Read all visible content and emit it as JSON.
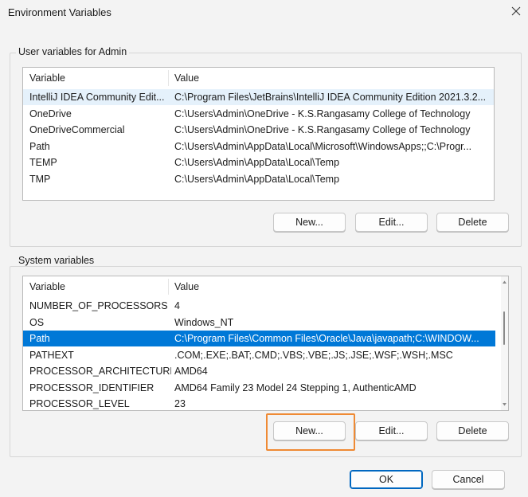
{
  "window": {
    "title": "Environment Variables",
    "close_icon": "close-icon"
  },
  "user_vars": {
    "group_label": "User variables for Admin",
    "columns": [
      "Variable",
      "Value"
    ],
    "rows": [
      [
        "IntelliJ IDEA Community Edit...",
        "C:\\Program Files\\JetBrains\\IntelliJ IDEA Community Edition 2021.3.2..."
      ],
      [
        "OneDrive",
        "C:\\Users\\Admin\\OneDrive - K.S.Rangasamy College of Technology"
      ],
      [
        "OneDriveCommercial",
        "C:\\Users\\Admin\\OneDrive - K.S.Rangasamy College of Technology"
      ],
      [
        "Path",
        "C:\\Users\\Admin\\AppData\\Local\\Microsoft\\WindowsApps;;C:\\Progr..."
      ],
      [
        "TEMP",
        "C:\\Users\\Admin\\AppData\\Local\\Temp"
      ],
      [
        "TMP",
        "C:\\Users\\Admin\\AppData\\Local\\Temp"
      ]
    ],
    "buttons": {
      "new": "New...",
      "edit": "Edit...",
      "delete": "Delete"
    }
  },
  "system_vars": {
    "group_label": "System variables",
    "columns": [
      "Variable",
      "Value"
    ],
    "rows": [
      [
        "NUMBER_OF_PROCESSORS",
        "4"
      ],
      [
        "OS",
        "Windows_NT"
      ],
      [
        "Path",
        "C:\\Program Files\\Common Files\\Oracle\\Java\\javapath;C:\\WINDOW..."
      ],
      [
        "PATHEXT",
        ".COM;.EXE;.BAT;.CMD;.VBS;.VBE;.JS;.JSE;.WSF;.WSH;.MSC"
      ],
      [
        "PROCESSOR_ARCHITECTURE",
        "AMD64"
      ],
      [
        "PROCESSOR_IDENTIFIER",
        "AMD64 Family 23 Model 24 Stepping 1, AuthenticAMD"
      ],
      [
        "PROCESSOR_LEVEL",
        "23"
      ]
    ],
    "selected_index": 2,
    "buttons": {
      "new": "New...",
      "edit": "Edit...",
      "delete": "Delete"
    }
  },
  "footer": {
    "ok": "OK",
    "cancel": "Cancel"
  },
  "colors": {
    "selection": "#0078d7",
    "callout": "#ef8a34",
    "primary_border": "#0067c0"
  }
}
